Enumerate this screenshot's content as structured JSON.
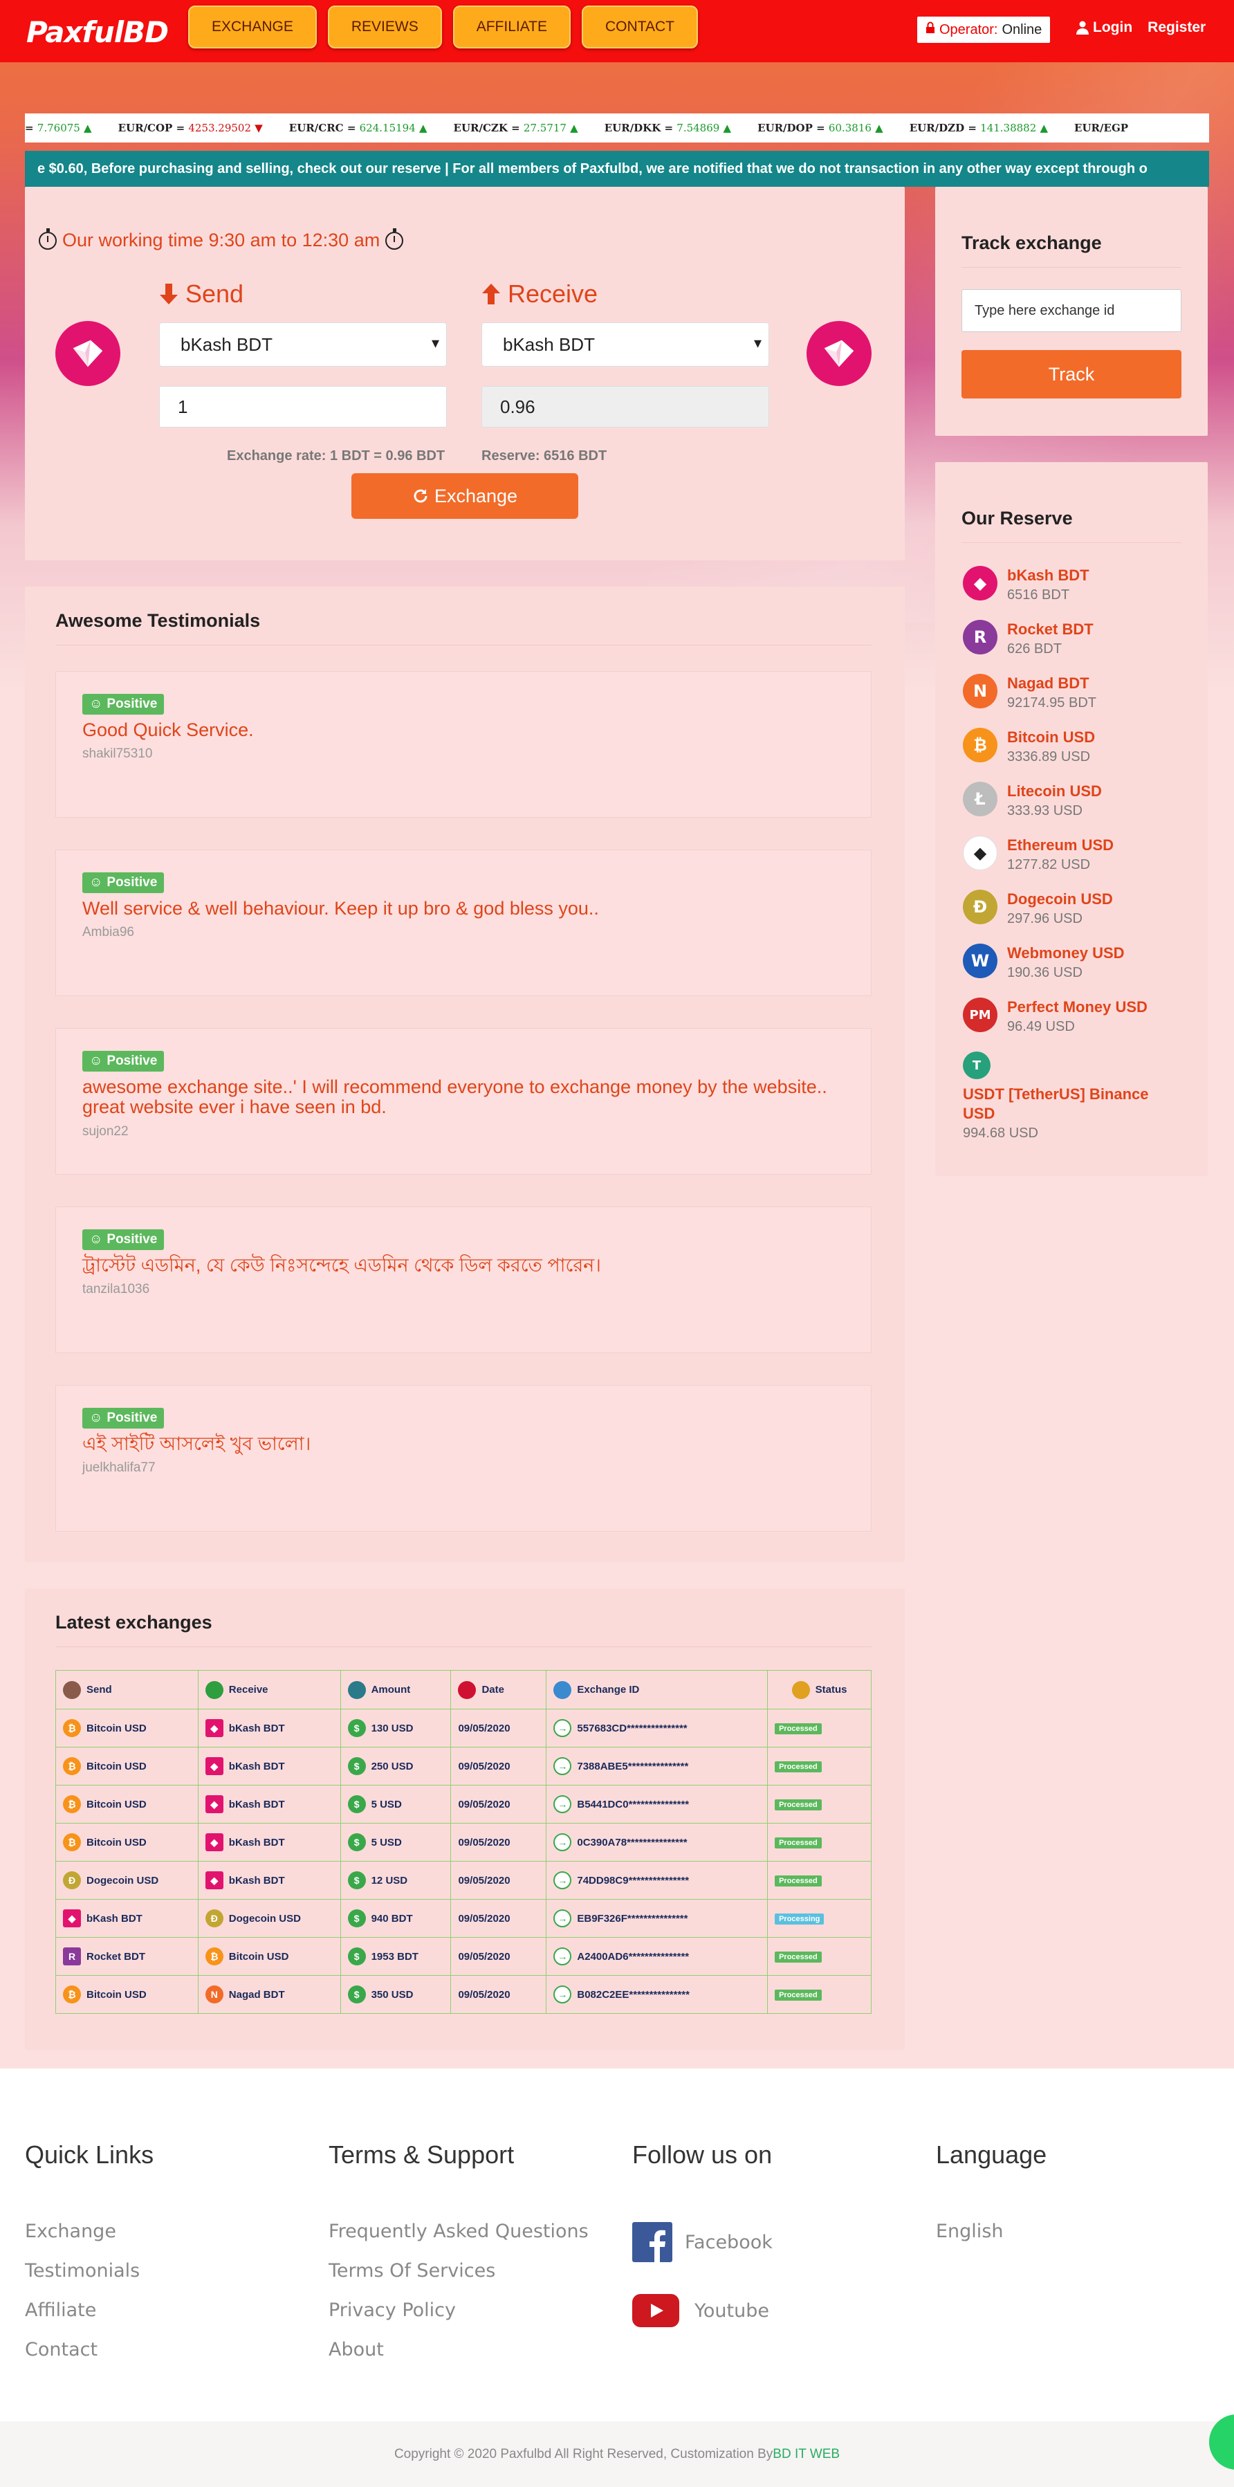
{
  "header": {
    "logo": "PaxfulBD",
    "nav": [
      "EXCHANGE",
      "REVIEWS",
      "AFFILIATE",
      "CONTACT"
    ],
    "operator_label": "Operator:",
    "operator_status": "Online",
    "login": "Login",
    "register": "Register",
    "colors": {
      "bar": "#f40e0e",
      "nav_button": "#ffaa1a",
      "accent": "#f26b29"
    }
  },
  "ticker": [
    {
      "pair": "",
      "value": "7.76075",
      "dir": "up"
    },
    {
      "pair": "EUR/COP",
      "value": "4253.29502",
      "dir": "down"
    },
    {
      "pair": "EUR/CRC",
      "value": "624.15194",
      "dir": "up"
    },
    {
      "pair": "EUR/CZK",
      "value": "27.5717",
      "dir": "up"
    },
    {
      "pair": "EUR/DKK",
      "value": "7.54869",
      "dir": "up"
    },
    {
      "pair": "EUR/DOP",
      "value": "60.3816",
      "dir": "up"
    },
    {
      "pair": "EUR/DZD",
      "value": "141.38882",
      "dir": "up"
    },
    {
      "pair": "EUR/EGP",
      "value": "",
      "dir": ""
    }
  ],
  "notice": "e $0.60, Before purchasing and selling, check out our reserve | For all members of Paxfulbd, we are notified that we do not transaction in any other way except through o",
  "exchange": {
    "working_time": "Our working time 9:30 am to 12:30 am",
    "send_label": "Send",
    "receive_label": "Receive",
    "send_gateway": "bKash BDT",
    "receive_gateway": "bKash BDT",
    "send_amount": "1",
    "receive_amount": "0.96",
    "rate": "Exchange rate: 1 BDT = 0.96 BDT",
    "reserve": "Reserve: 6516 BDT",
    "button": "Exchange"
  },
  "track": {
    "title": "Track exchange",
    "placeholder": "Type here exchange id",
    "button": "Track"
  },
  "reserve": {
    "title": "Our Reserve",
    "items": [
      {
        "name": "bKash BDT",
        "value": "6516 BDT",
        "icon": "bkash-icon",
        "color": "#e2136e"
      },
      {
        "name": "Rocket BDT",
        "value": "626 BDT",
        "icon": "rocket-icon",
        "color": "#8a3a9a"
      },
      {
        "name": "Nagad BDT",
        "value": "92174.95 BDT",
        "icon": "nagad-icon",
        "color": "#f26b29"
      },
      {
        "name": "Bitcoin USD",
        "value": "3336.89 USD",
        "icon": "bitcoin-icon",
        "color": "#f7931a"
      },
      {
        "name": "Litecoin USD",
        "value": "333.93 USD",
        "icon": "litecoin-icon",
        "color": "#bdbdbd"
      },
      {
        "name": "Ethereum USD",
        "value": "1277.82 USD",
        "icon": "ethereum-icon",
        "color": "#ffffff"
      },
      {
        "name": "Dogecoin USD",
        "value": "297.96 USD",
        "icon": "dogecoin-icon",
        "color": "#c2a633"
      },
      {
        "name": "Webmoney USD",
        "value": "190.36 USD",
        "icon": "webmoney-icon",
        "color": "#1e5bb8"
      },
      {
        "name": "Perfect Money USD",
        "value": "96.49 USD",
        "icon": "perfect-money-icon",
        "color": "#d52b2b"
      },
      {
        "name": "USDT [TetherUS] Binance USD",
        "value": "994.68 USD",
        "icon": "tether-icon",
        "color": "#26a17b"
      }
    ]
  },
  "testimonials": {
    "title": "Awesome Testimonials",
    "badge": "Positive",
    "items": [
      {
        "text": "Good Quick Service.",
        "user": "shakil75310"
      },
      {
        "text": "Well service & well behaviour. Keep it up bro & god bless you..",
        "user": "Ambia96"
      },
      {
        "text": "awesome exchange site..' I will recommend everyone to exchange money by the website.. great website ever i have seen in bd.",
        "user": "sujon22"
      },
      {
        "text": "ট্রাস্টেট এডমিন, যে কেউ নিঃসন্দেহে এডমিন থেকে ডিল করতে পারেন।",
        "user": "tanzila1036"
      },
      {
        "text": "এই সাইটি আসলেই খুব ভালো।",
        "user": "juelkhalifa77"
      }
    ]
  },
  "latest": {
    "title": "Latest exchanges",
    "columns": [
      "Send",
      "Receive",
      "Amount",
      "Date",
      "Exchange ID",
      "Status"
    ],
    "rows": [
      {
        "send": "Bitcoin USD",
        "receive": "bKash BDT",
        "amount": "130 USD",
        "date": "09/05/2020",
        "id": "557683CD***************",
        "status": "Processed"
      },
      {
        "send": "Bitcoin USD",
        "receive": "bKash BDT",
        "amount": "250 USD",
        "date": "09/05/2020",
        "id": "7388ABE5***************",
        "status": "Processed"
      },
      {
        "send": "Bitcoin USD",
        "receive": "bKash BDT",
        "amount": "5 USD",
        "date": "09/05/2020",
        "id": "B5441DC0***************",
        "status": "Processed"
      },
      {
        "send": "Bitcoin USD",
        "receive": "bKash BDT",
        "amount": "5 USD",
        "date": "09/05/2020",
        "id": "0C390A78***************",
        "status": "Processed"
      },
      {
        "send": "Dogecoin USD",
        "receive": "bKash BDT",
        "amount": "12 USD",
        "date": "09/05/2020",
        "id": "74DD98C9***************",
        "status": "Processed"
      },
      {
        "send": "bKash BDT",
        "receive": "Dogecoin USD",
        "amount": "940 BDT",
        "date": "09/05/2020",
        "id": "EB9F326F***************",
        "status": "Processing"
      },
      {
        "send": "Rocket BDT",
        "receive": "Bitcoin USD",
        "amount": "1953 BDT",
        "date": "09/05/2020",
        "id": "A2400AD6***************",
        "status": "Processed"
      },
      {
        "send": "Bitcoin USD",
        "receive": "Nagad BDT",
        "amount": "350 USD",
        "date": "09/05/2020",
        "id": "B082C2EE***************",
        "status": "Processed"
      }
    ]
  },
  "footer": {
    "quick_title": "Quick Links",
    "quick": [
      "Exchange",
      "Testimonials",
      "Affiliate",
      "Contact"
    ],
    "terms_title": "Terms & Support",
    "terms": [
      "Frequently Asked Questions",
      "Terms Of Services",
      "Privacy Policy",
      "About"
    ],
    "follow_title": "Follow us on",
    "follow": [
      "Facebook",
      "Youtube"
    ],
    "lang_title": "Language",
    "lang": "English",
    "copyright": "Copyright © 2020 Paxfulbd All Right Reserved, Customization By ",
    "credit": "BD IT WEB"
  }
}
